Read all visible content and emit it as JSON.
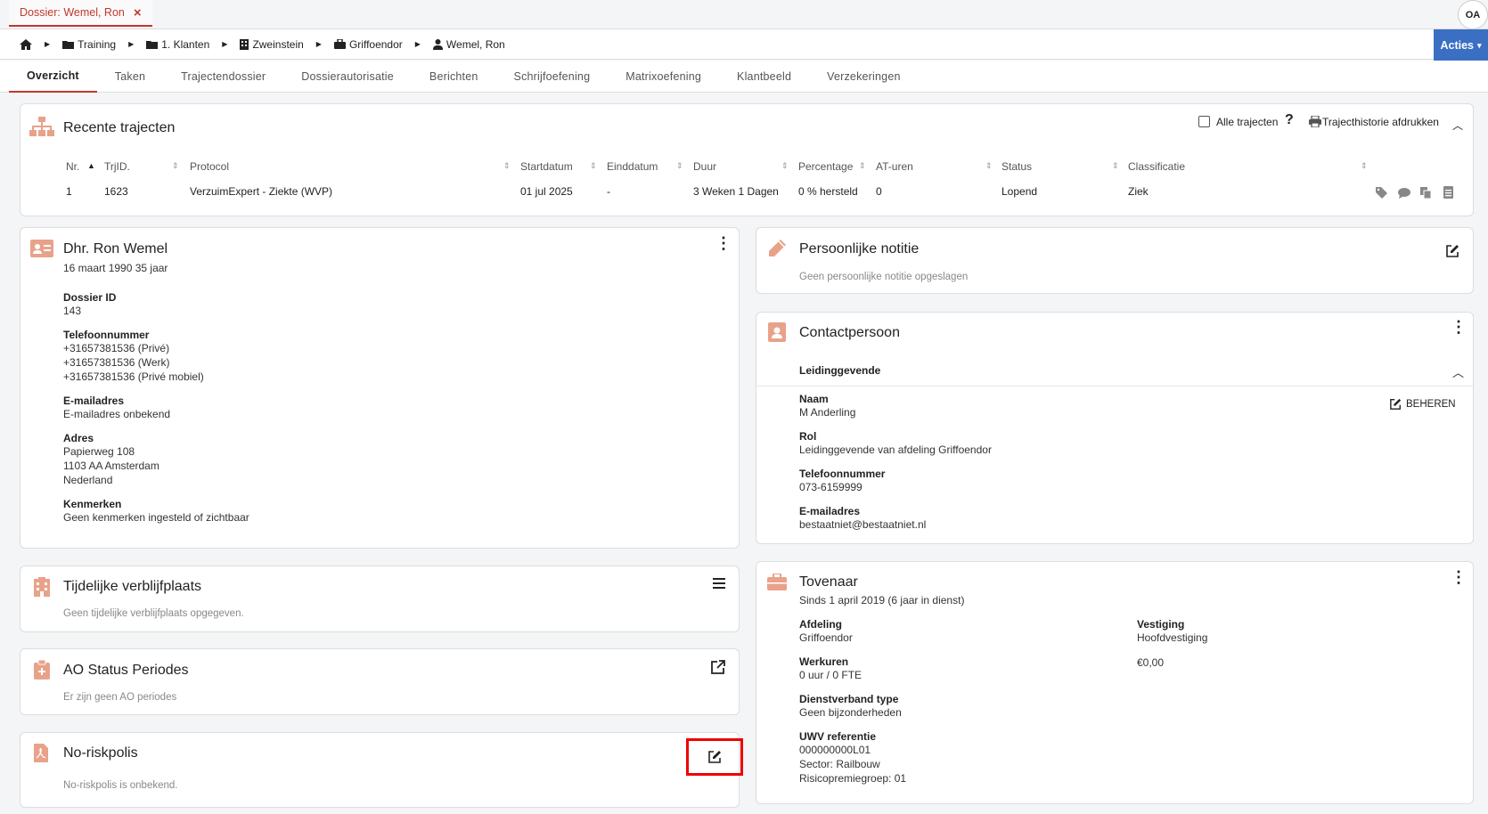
{
  "window": {
    "tab_title": "Dossier: Wemel, Ron",
    "tab_close": "×",
    "avatar": "OA"
  },
  "breadcrumb": [
    "Training",
    "1. Klanten",
    "Zweinstein",
    "Griffoendor",
    "Wemel, Ron"
  ],
  "acties": "Acties",
  "tabs": [
    "Overzicht",
    "Taken",
    "Trajectendossier",
    "Dossierautorisatie",
    "Berichten",
    "Schrijfoefening",
    "Matrixoefening",
    "Klantbeeld",
    "Verzekeringen"
  ],
  "trajecten": {
    "title": "Recente trajecten",
    "alle_label": "Alle trajecten",
    "print_label": "Trajecthistorie afdrukken",
    "columns": [
      "Nr.",
      "TrjID.",
      "Protocol",
      "Startdatum",
      "Einddatum",
      "Duur",
      "Percentage",
      "AT-uren",
      "Status",
      "Classificatie"
    ],
    "row": [
      "1",
      "1623",
      "VerzuimExpert - Ziekte (WVP)",
      "01 jul 2025",
      "-",
      "3 Weken 1 Dagen",
      "0 % hersteld",
      "0",
      "Lopend",
      "Ziek"
    ]
  },
  "person": {
    "name": "Dhr. Ron Wemel",
    "birth": "16 maart 1990 35 jaar",
    "dossier_label": "Dossier ID",
    "dossier": "143",
    "phone_label": "Telefoonnummer",
    "phones": [
      "+31657381536 (Privé)",
      "+31657381536 (Werk)",
      "+31657381536 (Privé mobiel)"
    ],
    "email_label": "E-mailadres",
    "email": "E-mailadres onbekend",
    "address_label": "Adres",
    "address": [
      "Papierweg 108",
      "1103 AA Amsterdam",
      "Nederland"
    ],
    "kenmerken_label": "Kenmerken",
    "kenmerken": "Geen kenmerken ingesteld of zichtbaar"
  },
  "verblijf": {
    "title": "Tijdelijke verblijfplaats",
    "text": "Geen tijdelijke verblijfplaats opgegeven."
  },
  "ao": {
    "title": "AO Status Periodes",
    "text": "Er zijn geen AO periodes"
  },
  "norisk": {
    "title": "No-riskpolis",
    "text": "No-riskpolis is onbekend."
  },
  "notitie": {
    "title": "Persoonlijke notitie",
    "text": "Geen persoonlijke notitie opgeslagen"
  },
  "contact": {
    "title": "Contactpersoon",
    "section": "Leidinggevende",
    "beheren": "BEHEREN",
    "naam_label": "Naam",
    "naam": "M Anderling",
    "rol_label": "Rol",
    "rol": "Leidinggevende van afdeling Griffoendor",
    "tel_label": "Telefoonnummer",
    "tel": "073-6159999",
    "email_label": "E-mailadres",
    "email": "bestaatniet@bestaatniet.nl"
  },
  "employer": {
    "title": "Tovenaar",
    "since": "Sinds 1 april 2019 (6 jaar in dienst)",
    "afdeling_label": "Afdeling",
    "afdeling": "Griffoendor",
    "vestiging_label": "Vestiging",
    "vestiging": "Hoofdvestiging",
    "werkuren_label": "Werkuren",
    "werkuren": "0 uur / 0 FTE",
    "salaris": "€0,00",
    "dienst_label": "Dienstverband type",
    "dienst": "Geen bijzonderheden",
    "uwv_label": "UWV referentie",
    "uwv": "000000000L01",
    "sector": "Sector: Railbouw",
    "risico": "Risicopremiegroep: 01"
  },
  "colors": {
    "accent": "#c0392b",
    "icon": "#e8a28a",
    "primary": "#3a6fc4",
    "highlight": "#e00000"
  }
}
